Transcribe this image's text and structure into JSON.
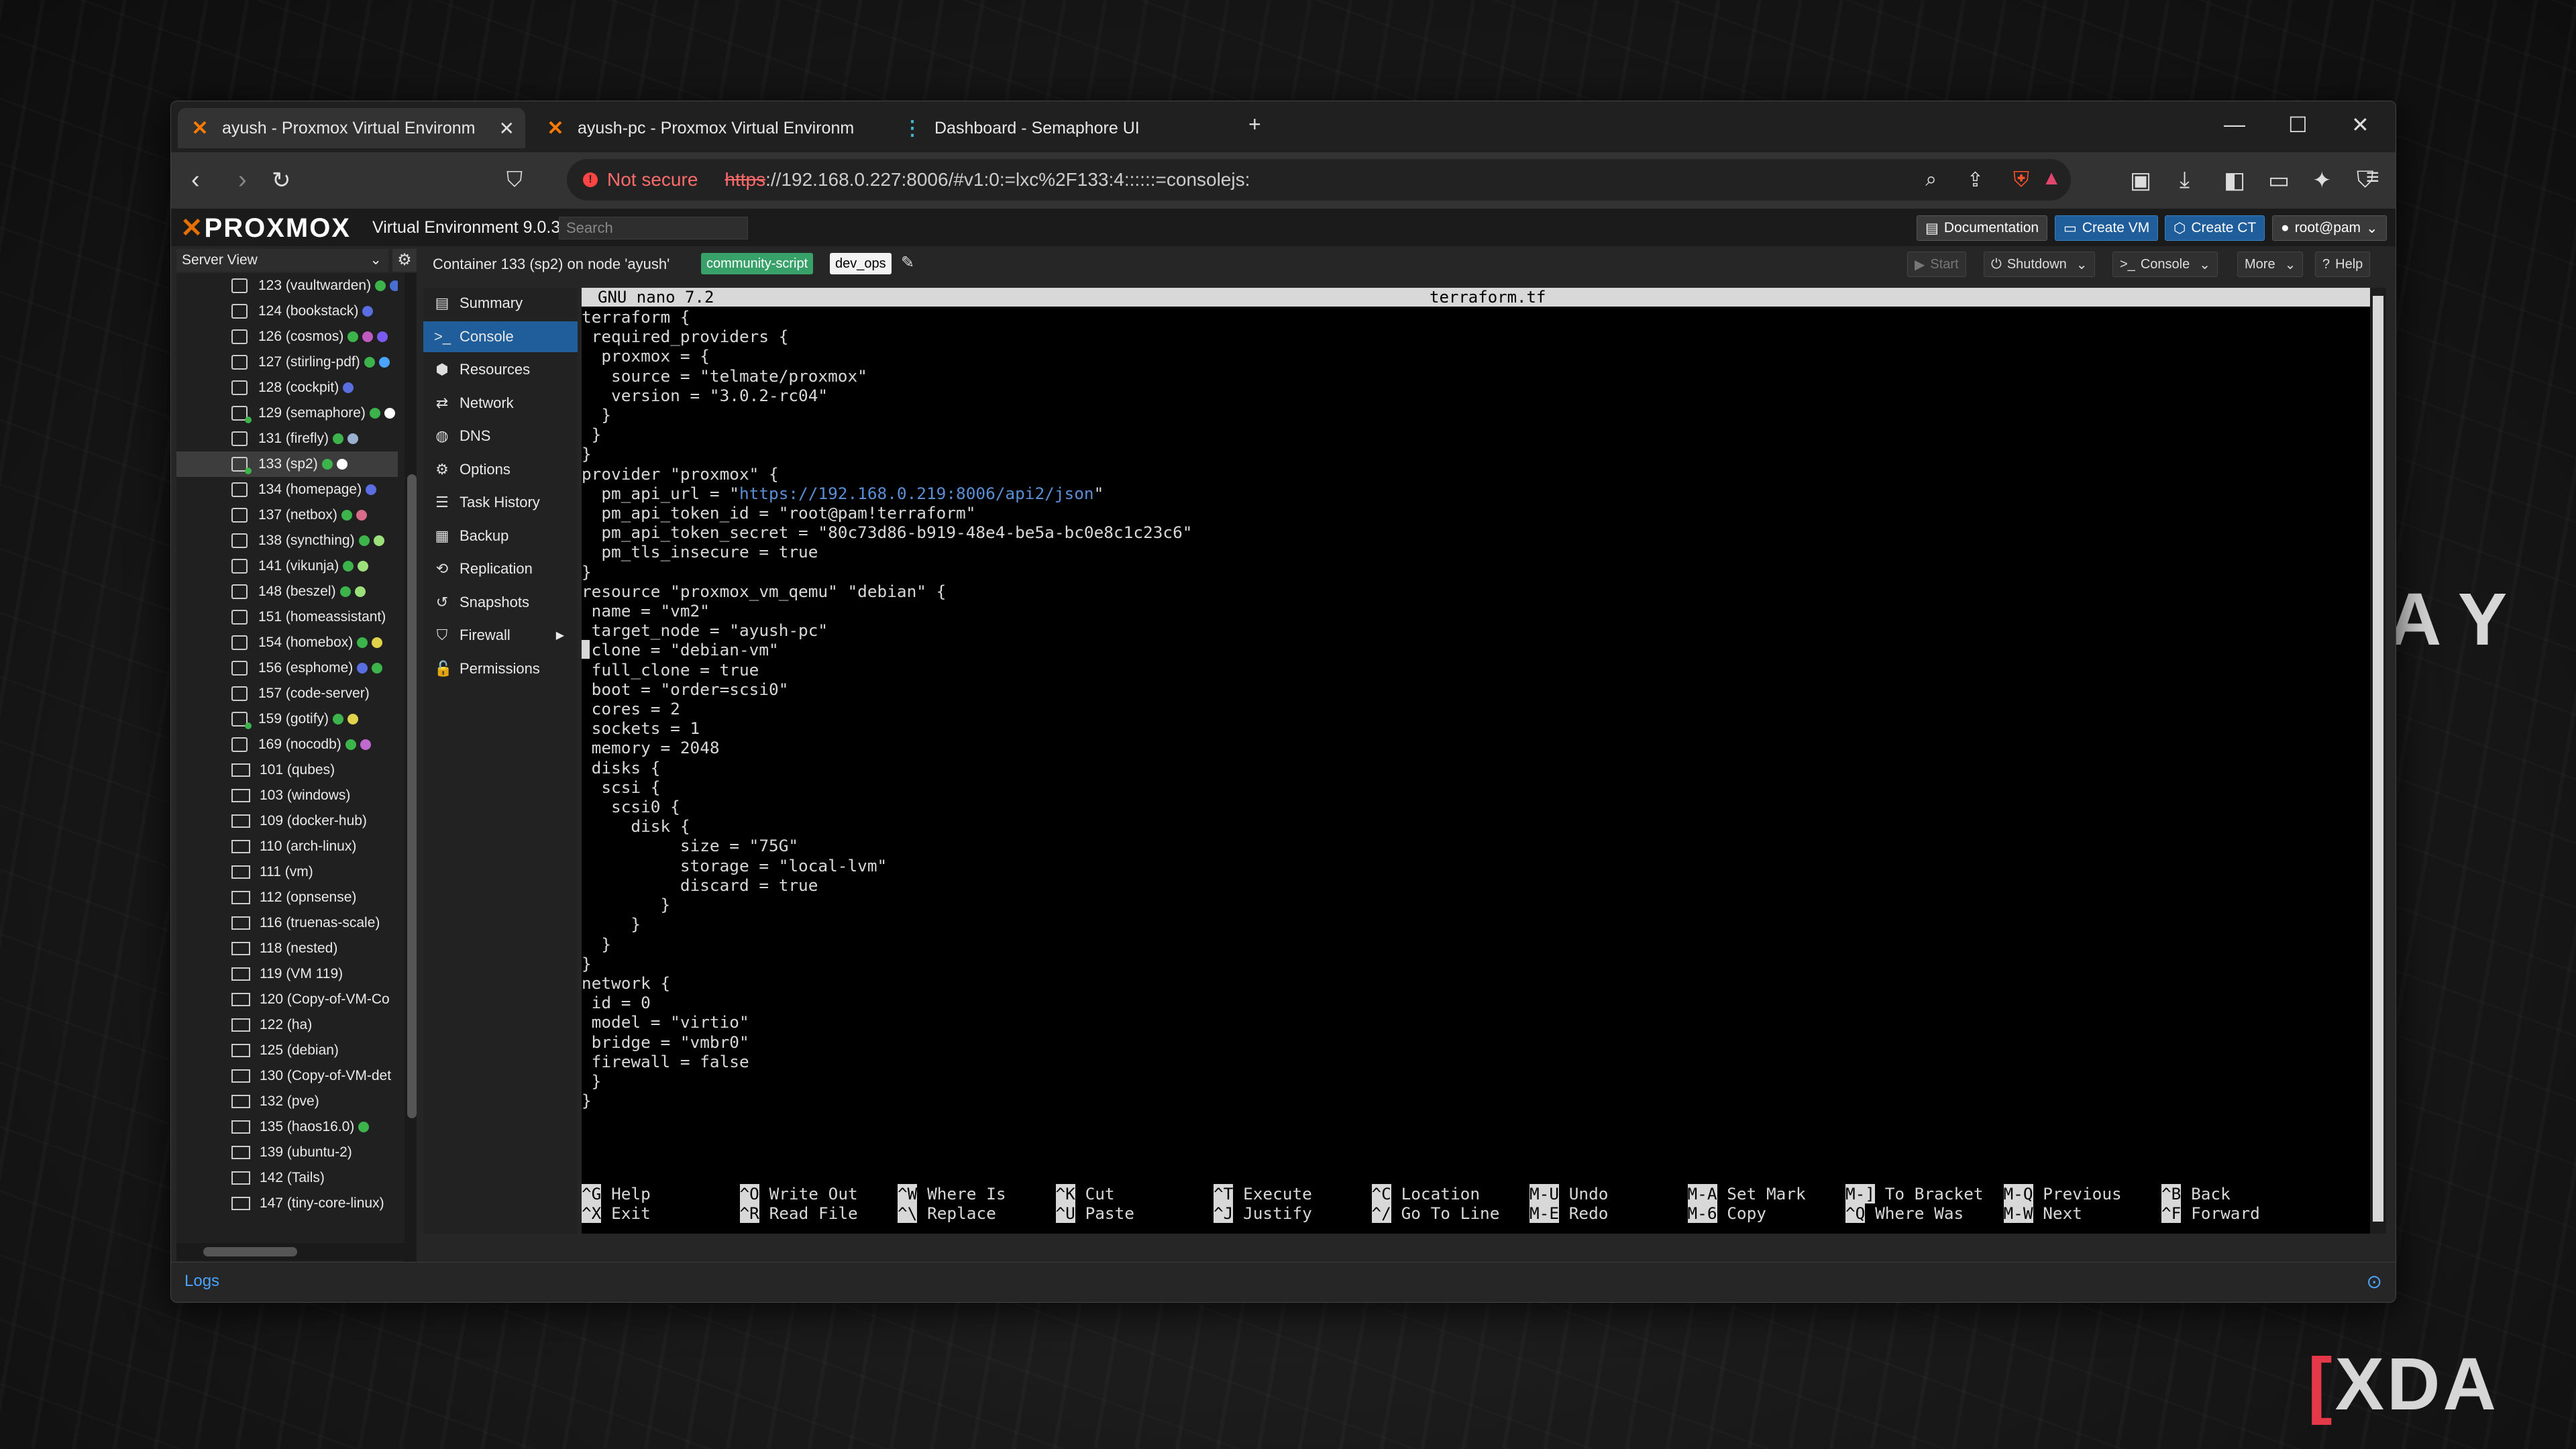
{
  "browser": {
    "tabs": [
      {
        "label": "ayush - Proxmox Virtual Environm",
        "active": true
      },
      {
        "label": "ayush-pc - Proxmox Virtual Environm",
        "active": false
      },
      {
        "label": "Dashboard - Semaphore UI",
        "active": false
      }
    ],
    "security_label": "Not secure",
    "url_scheme": "https",
    "url_rest": "://192.168.0.227:8006/#v1:0:=lxc%2F133:4::::::=consolejs:"
  },
  "pve": {
    "logo": "PROXMOX",
    "version": "Virtual Environment 9.0.3",
    "search_placeholder": "Search",
    "header_buttons": {
      "documentation": "Documentation",
      "create_vm": "Create VM",
      "create_ct": "Create CT",
      "user": "root@pam"
    },
    "tree_view_label": "Server View",
    "tree": [
      {
        "label": "123 (vaultwarden)",
        "kind": "ct",
        "tags": [
          "#3cb44b",
          "#4a6fd4"
        ]
      },
      {
        "label": "124 (bookstack)",
        "kind": "ct",
        "tags": [
          "#5b6ee1"
        ]
      },
      {
        "label": "126 (cosmos)",
        "kind": "ct",
        "tags": [
          "#3cb44b",
          "#c05ac0",
          "#7a5af0"
        ]
      },
      {
        "label": "127 (stirling-pdf)",
        "kind": "ct",
        "tags": [
          "#3cb44b",
          "#4aa3ff"
        ]
      },
      {
        "label": "128 (cockpit)",
        "kind": "ct",
        "tags": [
          "#5b6ee1"
        ]
      },
      {
        "label": "129 (semaphore)",
        "kind": "ct",
        "run": true,
        "tags": [
          "#3cb44b",
          "#ffffff"
        ]
      },
      {
        "label": "131 (firefly)",
        "kind": "ct",
        "tags": [
          "#3cb44b",
          "#9ab0d0"
        ]
      },
      {
        "label": "133 (sp2)",
        "kind": "ct",
        "run": true,
        "selected": true,
        "tags": [
          "#3cb44b",
          "#ffffff"
        ]
      },
      {
        "label": "134 (homepage)",
        "kind": "ct",
        "tags": [
          "#5b6ee1"
        ]
      },
      {
        "label": "137 (netbox)",
        "kind": "ct",
        "tags": [
          "#3cb44b",
          "#d86a8a"
        ]
      },
      {
        "label": "138 (syncthing)",
        "kind": "ct",
        "tags": [
          "#3cb44b",
          "#9be07a"
        ]
      },
      {
        "label": "141 (vikunja)",
        "kind": "ct",
        "tags": [
          "#3cb44b",
          "#9be07a"
        ]
      },
      {
        "label": "148 (beszel)",
        "kind": "ct",
        "tags": [
          "#3cb44b",
          "#9be07a"
        ]
      },
      {
        "label": "151 (homeassistant)",
        "kind": "ct",
        "tags": []
      },
      {
        "label": "154 (homebox)",
        "kind": "ct",
        "tags": [
          "#3cb44b",
          "#e0d24a"
        ]
      },
      {
        "label": "156 (esphome)",
        "kind": "ct",
        "tags": [
          "#5b6ee1",
          "#3cb44b"
        ]
      },
      {
        "label": "157 (code-server)",
        "kind": "ct",
        "tags": []
      },
      {
        "label": "159 (gotify)",
        "kind": "ct",
        "run": true,
        "tags": [
          "#3cb44b",
          "#e0d24a"
        ]
      },
      {
        "label": "169 (nocodb)",
        "kind": "ct",
        "tags": [
          "#3cb44b",
          "#c06ad0"
        ]
      },
      {
        "label": "101 (qubes)",
        "kind": "vm",
        "tags": []
      },
      {
        "label": "103 (windows)",
        "kind": "vm",
        "tags": []
      },
      {
        "label": "109 (docker-hub)",
        "kind": "vm",
        "tags": []
      },
      {
        "label": "110 (arch-linux)",
        "kind": "vm",
        "tags": []
      },
      {
        "label": "111 (vm)",
        "kind": "vm",
        "tags": []
      },
      {
        "label": "112 (opnsense)",
        "kind": "vm",
        "tags": []
      },
      {
        "label": "116 (truenas-scale)",
        "kind": "vm",
        "tags": []
      },
      {
        "label": "118 (nested)",
        "kind": "vm",
        "tags": []
      },
      {
        "label": "119 (VM 119)",
        "kind": "vm",
        "tags": []
      },
      {
        "label": "120 (Copy-of-VM-Co",
        "kind": "vm",
        "tags": []
      },
      {
        "label": "122 (ha)",
        "kind": "vm",
        "tags": []
      },
      {
        "label": "125 (debian)",
        "kind": "vm",
        "tags": []
      },
      {
        "label": "130 (Copy-of-VM-det",
        "kind": "vm",
        "tags": []
      },
      {
        "label": "132 (pve)",
        "kind": "vm",
        "tags": []
      },
      {
        "label": "135 (haos16.0)",
        "kind": "vm",
        "run": true,
        "tags": [
          "#3cb44b"
        ]
      },
      {
        "label": "139 (ubuntu-2)",
        "kind": "vm",
        "tags": []
      },
      {
        "label": "142 (Tails)",
        "kind": "vm",
        "tags": []
      },
      {
        "label": "147 (tiny-core-linux)",
        "kind": "vm",
        "tags": []
      }
    ],
    "content_title": "Container 133 (sp2) on node 'ayush'",
    "tags": [
      "community-script",
      "dev_ops"
    ],
    "toolbar": {
      "start": "Start",
      "shutdown": "Shutdown",
      "console": "Console",
      "more": "More",
      "help": "Help"
    },
    "menu": [
      {
        "label": "Summary",
        "icon": "▤"
      },
      {
        "label": "Console",
        "icon": ">_",
        "selected": true
      },
      {
        "label": "Resources",
        "icon": "⬢"
      },
      {
        "label": "Network",
        "icon": "⇄"
      },
      {
        "label": "DNS",
        "icon": "◍"
      },
      {
        "label": "Options",
        "icon": "⚙"
      },
      {
        "label": "Task History",
        "icon": "☰"
      },
      {
        "label": "Backup",
        "icon": "▦"
      },
      {
        "label": "Replication",
        "icon": "⟲"
      },
      {
        "label": "Snapshots",
        "icon": "↺"
      },
      {
        "label": "Firewall",
        "icon": "⛉",
        "arrow": true
      },
      {
        "label": "Permissions",
        "icon": "🔓"
      }
    ],
    "logs_label": "Logs"
  },
  "nano": {
    "app": "GNU nano 7.2",
    "filename": "terraform.tf",
    "lines": [
      "terraform {",
      " required_providers {",
      "  proxmox = {",
      "   source = \"telmate/proxmox\"",
      "   version = \"3.0.2-rc04\"",
      "  }",
      " }",
      "}",
      "provider \"proxmox\" {",
      "  pm_api_url = \"https://192.168.0.219:8006/api2/json\"",
      "  pm_api_token_id = \"root@pam!terraform\"",
      "  pm_api_token_secret = \"80c73d86-b919-48e4-be5a-bc0e8c1c23c6\"",
      "  pm_tls_insecure = true",
      "}",
      "resource \"proxmox_vm_qemu\" \"debian\" {",
      " name = \"vm2\"",
      " target_node = \"ayush-pc\"",
      " clone = \"debian-vm\"",
      " full_clone = true",
      " boot = \"order=scsi0\"",
      " cores = 2",
      " sockets = 1",
      " memory = 2048",
      " disks {",
      "  scsi {",
      "   scsi0 {",
      "     disk {",
      "          size = \"75G\"",
      "          storage = \"local-lvm\"",
      "          discard = true",
      "        }",
      "     }",
      "  }",
      "}",
      "network {",
      " id = 0",
      " model = \"virtio\"",
      " bridge = \"vmbr0\"",
      " firewall = false",
      " }",
      "}"
    ],
    "shortcuts_row1": [
      {
        "key": "^G",
        "label": "Help"
      },
      {
        "key": "^O",
        "label": "Write Out"
      },
      {
        "key": "^W",
        "label": "Where Is"
      },
      {
        "key": "^K",
        "label": "Cut"
      },
      {
        "key": "^T",
        "label": "Execute"
      },
      {
        "key": "^C",
        "label": "Location"
      },
      {
        "key": "M-U",
        "label": "Undo"
      },
      {
        "key": "M-A",
        "label": "Set Mark"
      },
      {
        "key": "M-]",
        "label": "To Bracket"
      },
      {
        "key": "M-Q",
        "label": "Previous"
      },
      {
        "key": "^B",
        "label": "Back"
      }
    ],
    "shortcuts_row2": [
      {
        "key": "^X",
        "label": "Exit"
      },
      {
        "key": "^R",
        "label": "Read File"
      },
      {
        "key": "^\\",
        "label": "Replace"
      },
      {
        "key": "^U",
        "label": "Paste"
      },
      {
        "key": "^J",
        "label": "Justify"
      },
      {
        "key": "^/",
        "label": "Go To Line"
      },
      {
        "key": "M-E",
        "label": "Redo"
      },
      {
        "key": "M-6",
        "label": "Copy"
      },
      {
        "key": "^Q",
        "label": "Where Was"
      },
      {
        "key": "M-W",
        "label": "Next"
      },
      {
        "key": "^F",
        "label": "Forward"
      }
    ]
  },
  "watermark": {
    "brand": "XDA"
  },
  "colors": {
    "accent": "#1f5e9b",
    "proxmox_orange": "#e57000",
    "url_link": "#5a8fd6"
  }
}
